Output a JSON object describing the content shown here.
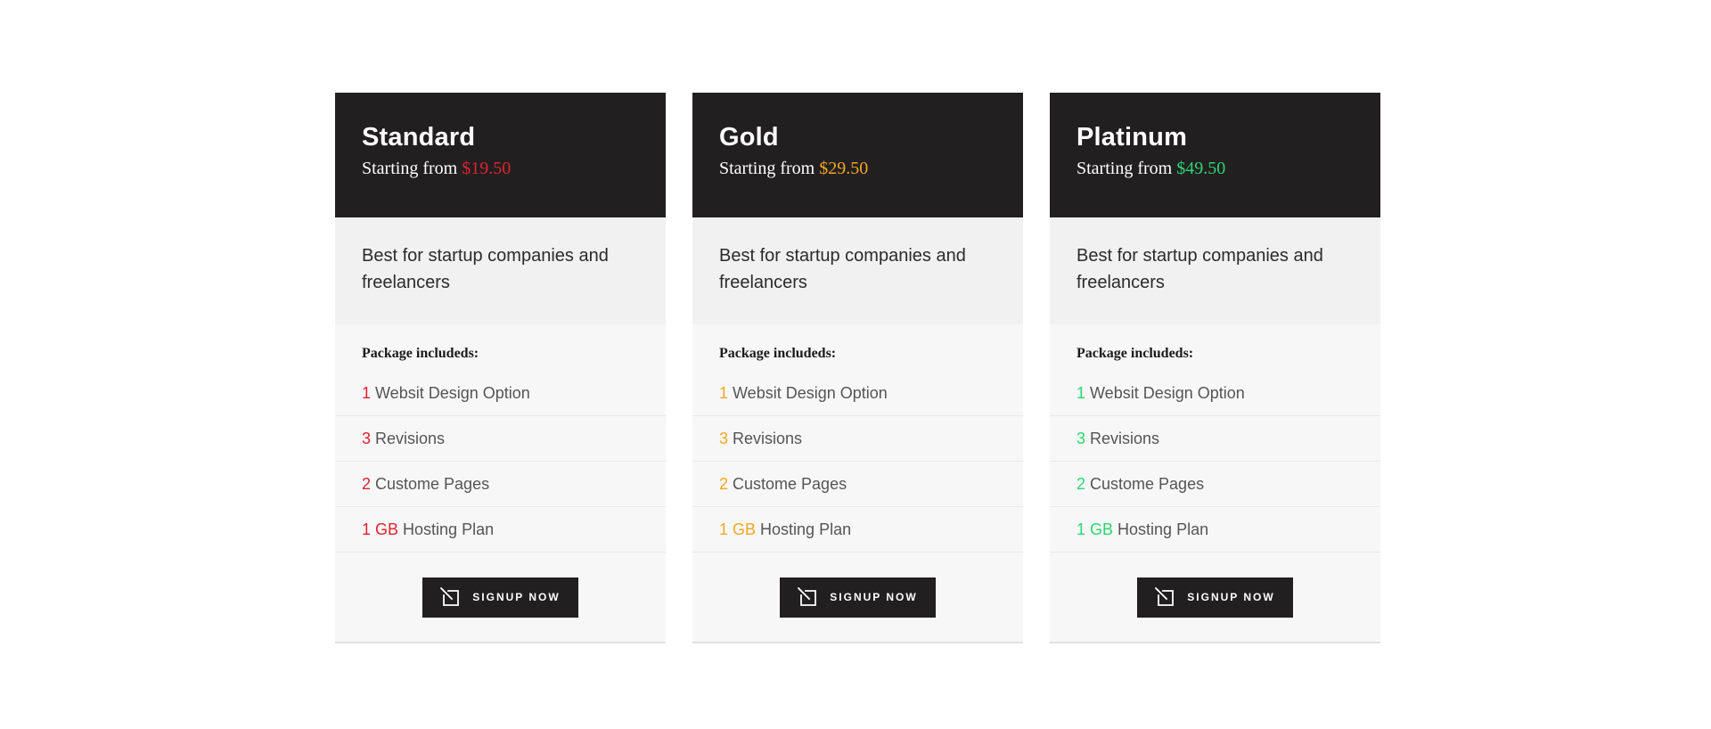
{
  "plans": [
    {
      "name": "Standard",
      "starting_text": "Starting from ",
      "price": "$19.50",
      "accent_color": "#e0222f",
      "description": "Best for startup companies and freelancers",
      "package_title": "Package includeds:",
      "features": [
        {
          "highlight": "1",
          "text": " Websit Design Option"
        },
        {
          "highlight": "3",
          "text": " Revisions"
        },
        {
          "highlight": "2",
          "text": " Custome Pages"
        },
        {
          "highlight": "1 GB",
          "text": " Hosting Plan"
        }
      ],
      "button_label": "Signup Now",
      "button_icon": "pen-square-icon"
    },
    {
      "name": "Gold",
      "starting_text": "Starting from ",
      "price": "$29.50",
      "accent_color": "#f5a623",
      "description": "Best for startup companies and freelancers",
      "package_title": "Package includeds:",
      "features": [
        {
          "highlight": "1",
          "text": " Websit Design Option"
        },
        {
          "highlight": "3",
          "text": " Revisions"
        },
        {
          "highlight": "2",
          "text": " Custome Pages"
        },
        {
          "highlight": "1 GB",
          "text": " Hosting Plan"
        }
      ],
      "button_label": "Signup Now",
      "button_icon": "pen-square-icon"
    },
    {
      "name": "Platinum",
      "starting_text": "Starting from ",
      "price": "$49.50",
      "accent_color": "#2ed573",
      "description": "Best for startup companies and freelancers",
      "package_title": "Package includeds:",
      "features": [
        {
          "highlight": "1",
          "text": " Websit Design Option"
        },
        {
          "highlight": "3",
          "text": " Revisions"
        },
        {
          "highlight": "2",
          "text": " Custome Pages"
        },
        {
          "highlight": "1 GB",
          "text": " Hosting Plan"
        }
      ],
      "button_label": "Signup Now",
      "button_icon": "pen-square-icon"
    }
  ]
}
